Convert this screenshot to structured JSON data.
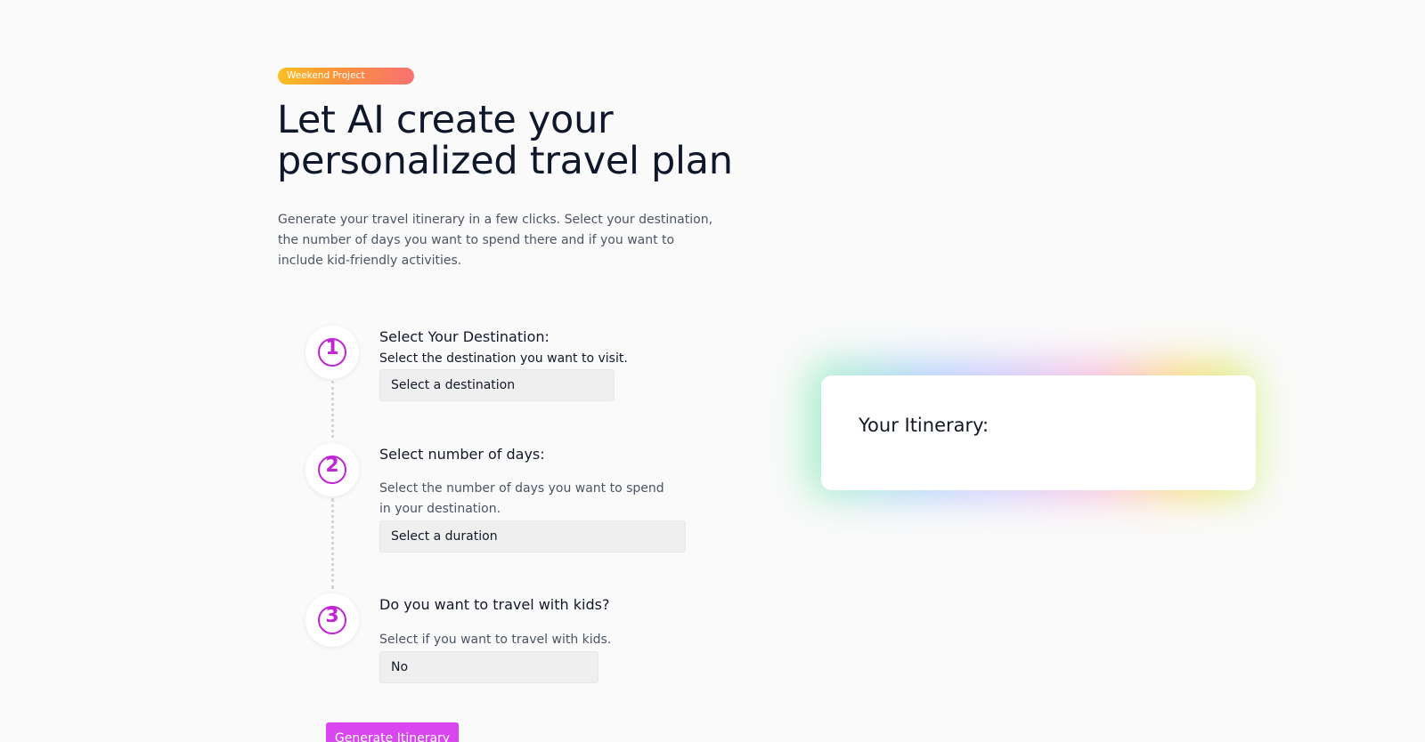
{
  "hero": {
    "badge": "Weekend Project",
    "title": "Let AI create your personalized travel plan",
    "subtitle": "Generate your travel itinerary in a few clicks. Select your destination, the number of days you want to spend there and if you want to include kid-friendly activities."
  },
  "steps": [
    {
      "number": "1",
      "title": "Select Your Destination:",
      "description": "Select the destination you want to visit.",
      "select_value": "Select a destination"
    },
    {
      "number": "2",
      "title": "Select number of days:",
      "description": "Select the number of days you want to spend in your destination.",
      "select_value": "Select a duration"
    },
    {
      "number": "3",
      "title": "Do you want to travel with kids?",
      "description": "Select if you want to travel with kids.",
      "select_value": "No"
    }
  ],
  "generate_button": "Generate Itinerary",
  "itinerary": {
    "title": "Your Itinerary:"
  },
  "colors": {
    "accent": "#d946ef",
    "step_number": "#c026d3"
  }
}
